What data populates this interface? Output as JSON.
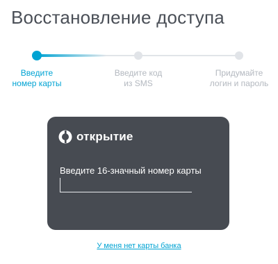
{
  "page": {
    "title": "Восстановление доступа"
  },
  "stepper": {
    "steps": [
      {
        "line1": "Введите",
        "line2": "номер карты",
        "state": "active"
      },
      {
        "line1": "Введите код",
        "line2": "из SMS",
        "state": "inactive"
      },
      {
        "line1": "Придумайте",
        "line2": "логин и пароль",
        "state": "inactive"
      }
    ]
  },
  "card": {
    "brand_name": "открытие",
    "input_label": "Введите 16-значный номер карты",
    "input_value": "",
    "input_placeholder": ""
  },
  "links": {
    "no_card": "У меня нет карты банка"
  },
  "colors": {
    "accent": "#00a3d3",
    "title": "#4a4f57",
    "inactive": "#b3b8bf",
    "card_bg": "#474b52"
  }
}
